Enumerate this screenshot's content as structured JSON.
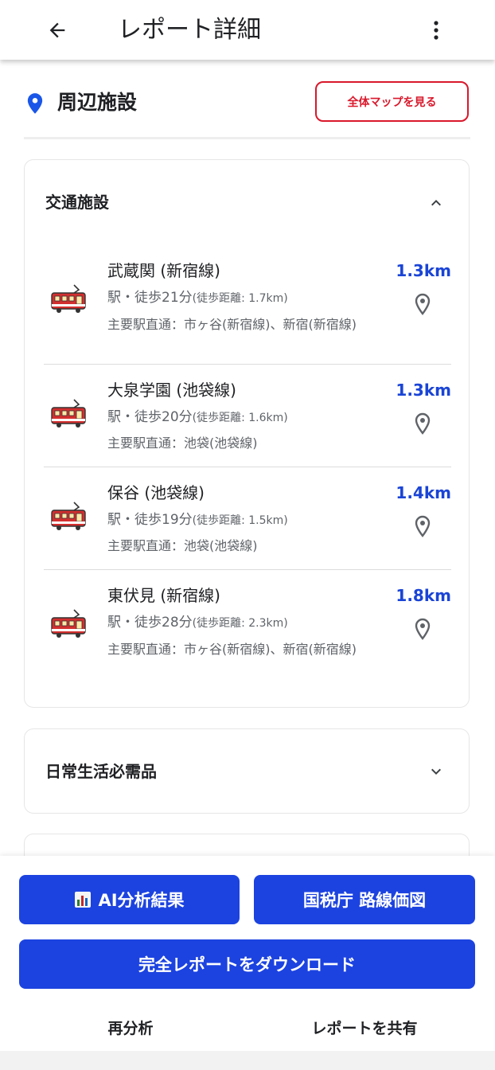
{
  "header": {
    "title": "レポート詳細"
  },
  "section": {
    "title": "周辺施設",
    "map_button": "全体マップを見る"
  },
  "transport": {
    "title": "交通施設",
    "stations": [
      {
        "name": "武蔵関 (新宿線)",
        "walk": "駅・徒歩21分",
        "walk_distance": "(徒歩距離: 1.7km)",
        "direct": "主要駅直通：市ヶ谷(新宿線)、新宿(新宿線)",
        "distance": "1.3km"
      },
      {
        "name": "大泉学園 (池袋線)",
        "walk": "駅・徒歩20分",
        "walk_distance": "(徒歩距離: 1.6km)",
        "direct": "主要駅直通：池袋(池袋線)",
        "distance": "1.3km"
      },
      {
        "name": "保谷 (池袋線)",
        "walk": "駅・徒歩19分",
        "walk_distance": "(徒歩距離: 1.5km)",
        "direct": "主要駅直通：池袋(池袋線)",
        "distance": "1.4km"
      },
      {
        "name": "東伏見 (新宿線)",
        "walk": "駅・徒歩28分",
        "walk_distance": "(徒歩距離: 2.3km)",
        "direct": "主要駅直通：市ヶ谷(新宿線)、新宿(新宿線)",
        "distance": "1.8km"
      }
    ]
  },
  "daily": {
    "title": "日常生活必需品"
  },
  "actions": {
    "ai_label": "AI分析結果",
    "ai_icon": "bar-chart-icon",
    "tax_label": "国税庁 路線価図",
    "download_label": "完全レポートをダウンロード",
    "reanalyze_label": "再分析",
    "share_label": "レポートを共有"
  },
  "colors": {
    "accent": "#1c43e0",
    "distance": "#1a44d6",
    "map_button": "#d9182b",
    "pin": "#1a56e8",
    "train_red": "#d32f2f"
  }
}
